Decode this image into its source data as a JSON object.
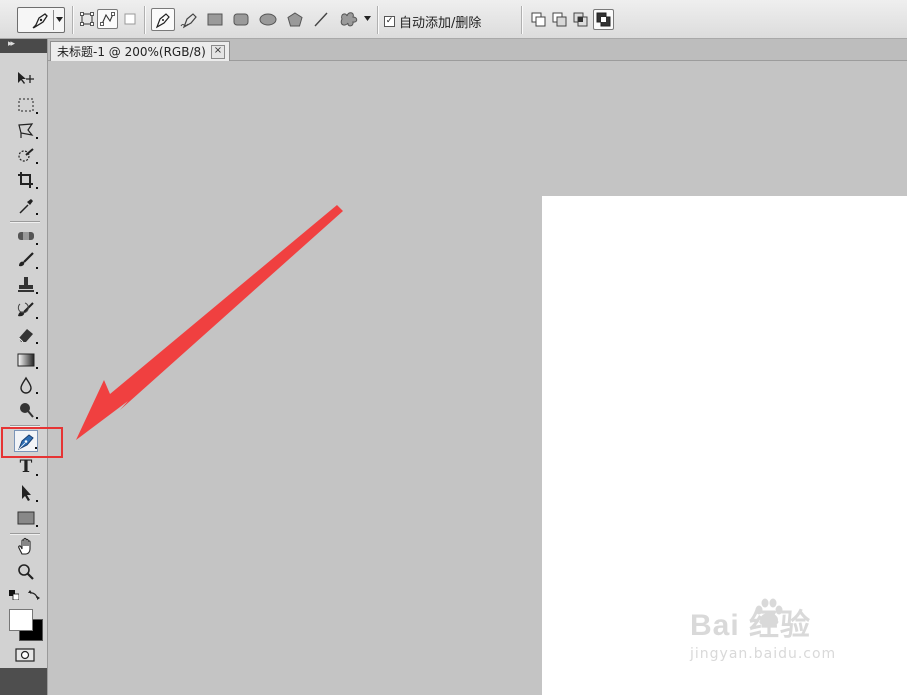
{
  "options_bar": {
    "auto_add_delete_label": "自动添加/删除",
    "auto_add_delete_checked": true
  },
  "document": {
    "tab_title": "未标题-1 @ 200%(RGB/8)",
    "close_glyph": "×"
  },
  "toolbox": {
    "tools": [
      "move-tool",
      "rectangular-marquee-tool",
      "lasso-tool",
      "quick-selection-tool",
      "crop-tool",
      "eyedropper-tool",
      "spot-healing-tool",
      "brush-tool",
      "clone-stamp-tool",
      "history-brush-tool",
      "eraser-tool",
      "gradient-tool",
      "blur-tool",
      "dodge-tool",
      "pen-tool",
      "type-tool",
      "path-selection-tool",
      "rectangle-tool",
      "hand-tool",
      "zoom-tool"
    ],
    "active_tool": "pen-tool",
    "type_glyph": "T",
    "foreground_color": "#ffffff",
    "background_color": "#000000"
  },
  "annotation": {
    "arrow_color": "#f04040",
    "highlight_color": "#e63434"
  },
  "watermark": {
    "brand": "Bai  经验",
    "url": "jingyan.baidu.com"
  }
}
